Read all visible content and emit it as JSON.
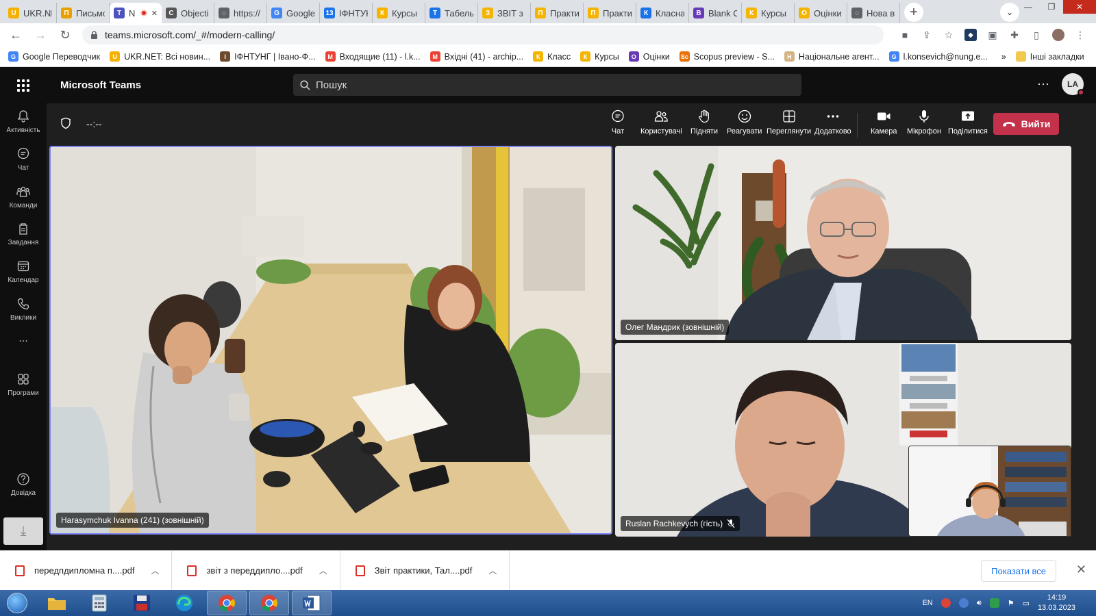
{
  "browser": {
    "tabs": [
      {
        "label": "UKR.NE",
        "color": "#f6b100",
        "glyph": "U"
      },
      {
        "label": "Письмо",
        "color": "#e8a000",
        "glyph": "П"
      },
      {
        "label": "N",
        "color": "#4b53bc",
        "glyph": "T",
        "active": true,
        "recording": true
      },
      {
        "label": "Objecti",
        "color": "#555555",
        "glyph": "C"
      },
      {
        "label": "https://",
        "color": "#5f6368",
        "glyph": "◌"
      },
      {
        "label": "Google",
        "color": "#4285f4",
        "glyph": "G"
      },
      {
        "label": "ІФНТУН",
        "color": "#1a73e8",
        "glyph": "13"
      },
      {
        "label": "Курсы",
        "color": "#f4b400",
        "glyph": "К"
      },
      {
        "label": "Табель",
        "color": "#1a73e8",
        "glyph": "Т"
      },
      {
        "label": "ЗВІТ з п",
        "color": "#f4b400",
        "glyph": "З"
      },
      {
        "label": "Практи",
        "color": "#f4b400",
        "glyph": "П"
      },
      {
        "label": "Практи",
        "color": "#f4b400",
        "glyph": "П"
      },
      {
        "label": "Класна",
        "color": "#1a73e8",
        "glyph": "К"
      },
      {
        "label": "Blank C",
        "color": "#673ab7",
        "glyph": "B"
      },
      {
        "label": "Курсы",
        "color": "#f4b400",
        "glyph": "К"
      },
      {
        "label": "Оцінки",
        "color": "#f4b400",
        "glyph": "О"
      },
      {
        "label": "Нова в",
        "color": "#5f6368",
        "glyph": "◌"
      }
    ],
    "url": "teams.microsoft.com/_#/modern-calling/",
    "bookmarks": [
      {
        "label": "Google Переводчик",
        "color": "#4285f4",
        "glyph": "G"
      },
      {
        "label": "UKR.NET: Всі новин...",
        "color": "#f6b100",
        "glyph": "U"
      },
      {
        "label": "ІФНТУНГ | Івано-Ф...",
        "color": "#6d4c2e",
        "glyph": "І"
      },
      {
        "label": "Входящие (11) - l.k...",
        "color": "#ea4335",
        "glyph": "M"
      },
      {
        "label": "Вхідні (41) - archip...",
        "color": "#ea4335",
        "glyph": "M"
      },
      {
        "label": "Класс",
        "color": "#f4b400",
        "glyph": "К"
      },
      {
        "label": "Курсы",
        "color": "#f4b400",
        "glyph": "К"
      },
      {
        "label": "Оцінки",
        "color": "#673ab7",
        "glyph": "О"
      },
      {
        "label": "Scopus preview - S...",
        "color": "#e8710a",
        "glyph": "Sc"
      },
      {
        "label": "Національне агент...",
        "color": "#d4b483",
        "glyph": "Н"
      },
      {
        "label": "l.konsevich@nung.e...",
        "color": "#4285f4",
        "glyph": "G"
      }
    ],
    "bookmarks_more": "»",
    "other_bookmarks": "Інші закладки"
  },
  "teams": {
    "app_title": "Microsoft Teams",
    "search_placeholder": "Пошук",
    "user_initials": "LA",
    "rail": [
      "Активність",
      "Чат",
      "Команди",
      "Завдання",
      "Календар",
      "Виклики",
      "...",
      "Програми",
      "Довідка"
    ],
    "call": {
      "timer": "--:--",
      "controls": [
        "Чат",
        "Користувачі",
        "Підняти",
        "Реагувати",
        "Переглянути",
        "Додатково",
        "Камера",
        "Мікрофон",
        "Поділитися"
      ],
      "leave": "Вийти"
    },
    "participants": [
      {
        "name": "Harasymchuk Ivanna (241) (зовнішній)",
        "active_speaker": true
      },
      {
        "name": "Олег Мандрик (зовнішній)"
      },
      {
        "name": "Ruslan Rachkevych (гість)",
        "muted": true
      }
    ]
  },
  "downloads": {
    "items": [
      "передпдипломна п....pdf",
      "звіт з переддипло....pdf",
      "Звіт практики, Тал....pdf"
    ],
    "show_all": "Показати все"
  },
  "taskbar": {
    "language": "EN",
    "time": "14:19",
    "date": "13.03.2023"
  },
  "colors": {
    "accent": "#7f85f5",
    "leave": "#c4314b",
    "teams_dark": "#1f1f1f"
  }
}
